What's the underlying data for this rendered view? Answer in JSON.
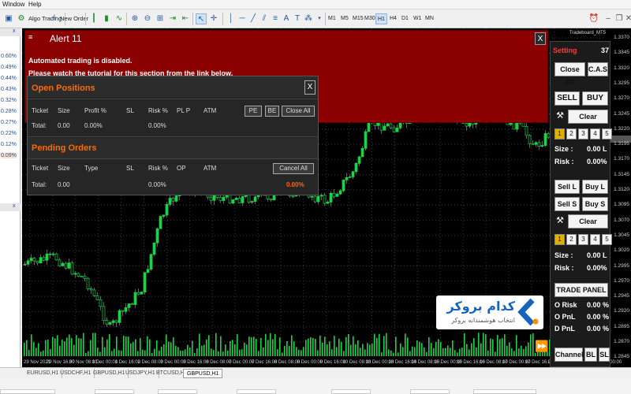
{
  "menu": {
    "window": "Window",
    "help": "Help"
  },
  "toolbar": {
    "algo_trading": "Algo Trading",
    "new_order": "New Order",
    "timeframes": [
      "M1",
      "M5",
      "M15",
      "M30",
      "H1",
      "H4",
      "D1",
      "W1",
      "MN"
    ],
    "active_timeframe": "H1"
  },
  "left_panel": {
    "values": [
      "0.60%",
      "0.49%",
      "0.44%",
      "0.43%",
      "0.32%",
      "0.28%",
      "0.27%",
      "0.22%",
      "0.12%",
      "0.09%"
    ]
  },
  "chart": {
    "symbol_label": "Tradeboard_MT5",
    "price_ticks": [
      "1.3370",
      "1.3345",
      "1.3320",
      "1.3295",
      "1.3270",
      "1.3245",
      "1.3220",
      "1.3195",
      "1.3170",
      "1.3145",
      "1.3120",
      "1.3095",
      "1.3070",
      "1.3045",
      "1.3020",
      "1.2995",
      "1.2970",
      "1.2945",
      "1.2920",
      "1.2895",
      "1.2870",
      "1.2845"
    ],
    "time_ticks": [
      "29 Nov 2021",
      "29 Nov 16:00",
      "30 Nov 08:00",
      "1 Dec 00:00",
      "1 Dec 16:00",
      "2 Dec 08:00",
      "3 Dec 00:00",
      "3 Dec 16:00",
      "6 Dec 08:00",
      "7 Dec 00:00",
      "7 Dec 16:00",
      "8 Dec 08:00",
      "9 Dec 00:00",
      "9 Dec 16:00",
      "10 Dec 08:00",
      "13 Dec 00:00",
      "13 Dec 16:00",
      "14 Dec 08:00",
      "15 Dec 00:00",
      "15 Dec 16:00",
      "16 Dec 08:00",
      "17 Dec 00:00",
      "17 Dec 16:00",
      "20 Dec 08:00",
      "21 Dec 00:00",
      "22 Dec 00:00"
    ]
  },
  "alert": {
    "title": "Alert 11",
    "close": "X",
    "line1": "Automated trading is disabled.",
    "line2": "Please watch the tutorial for this section from the link below."
  },
  "open_positions": {
    "title": "Open Positions",
    "close": "X",
    "columns": [
      "Ticket",
      "Size",
      "Profit %",
      "SL",
      "Risk %",
      "PL P",
      "ATM"
    ],
    "buttons": {
      "pe": "PE",
      "be": "BE",
      "close_all": "Close All"
    },
    "total_label": "Total:",
    "total_size": "0.00",
    "total_profit": "0.00%",
    "total_risk": "0.00%"
  },
  "pending_orders": {
    "title": "Pending Orders",
    "columns": [
      "Ticket",
      "Size",
      "Type",
      "SL",
      "Risk %",
      "OP",
      "ATM"
    ],
    "cancel_all": "Cancel All",
    "total_label": "Total:",
    "total_size": "0.00",
    "total_risk": "0.00%",
    "total_extra": "0.00%"
  },
  "side_panel": {
    "setting_label": "Setting",
    "setting_value": "37",
    "close_all": "Close All",
    "cas": "C.A.S",
    "sell": "SELL",
    "buy": "BUY",
    "clear1": "Clear",
    "nums": [
      "1",
      "2",
      "3",
      "4",
      "5"
    ],
    "size_label": "Size :",
    "size_value": "0.00 L",
    "risk_label": "Risk :",
    "risk_value": "0.00%",
    "sell_l": "Sell L",
    "buy_l": "Buy L",
    "sell_s": "Sell S",
    "buy_s": "Buy S",
    "clear2": "Clear",
    "size_label2": "Size :",
    "size_value2": "0.00 L",
    "risk_label2": "Risk :",
    "risk_value2": "0.00%",
    "trade_panel": "TRADE PANEL",
    "o_risk_label": "O Risk",
    "o_risk_value": "0.00 %",
    "o_pnl_label": "O PnL",
    "o_pnl_value": "0.00 %",
    "d_pnl_label": "D PnL",
    "d_pnl_value": "0.00 %",
    "channel": "Channel",
    "bl": "BL",
    "sl": "SL"
  },
  "logo": {
    "name": "کدام بروکر",
    "tagline": "انتخاب هوشمندانه بروکر"
  },
  "tabs": [
    "EURUSD,H1",
    "USDCHF,H1",
    "GBPUSD,H1",
    "USDJPY,H1",
    "BTCUSD,H1",
    "GBPUSD,H1"
  ],
  "active_tab": 5,
  "colors": {
    "alert_bg": "#8b0000",
    "accent_orange": "#ff6a00",
    "candle_green": "#1fd14a",
    "active_num": "#e0b000"
  }
}
